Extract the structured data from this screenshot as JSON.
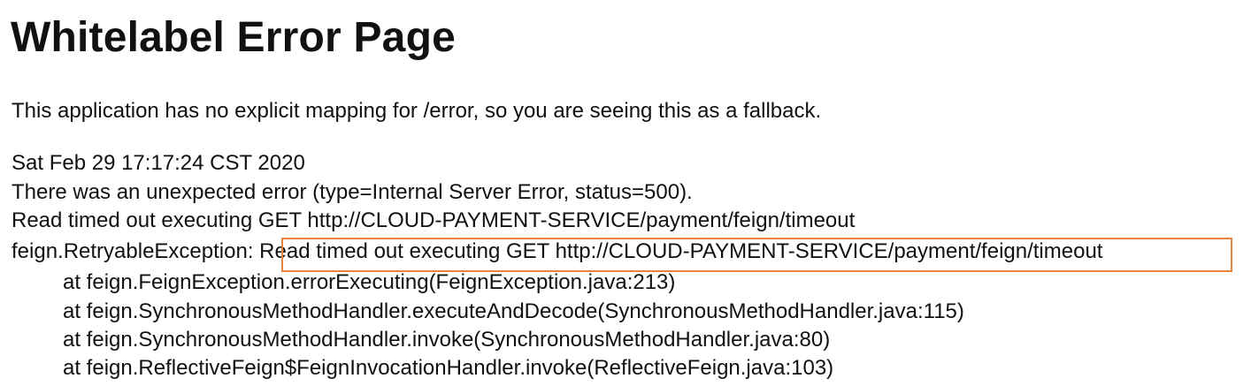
{
  "page": {
    "title": "Whitelabel Error Page",
    "fallback_message": "This application has no explicit mapping for /error, so you are seeing this as a fallback.",
    "timestamp": "Sat Feb 29 17:17:24 CST 2020",
    "error_summary": "There was an unexpected error (type=Internal Server Error, status=500).",
    "error_message": "Read timed out executing GET http://CLOUD-PAYMENT-SERVICE/payment/feign/timeout",
    "exception": {
      "prefix": "feign.RetryableException: ",
      "message": "Read timed out executing GET http://CLOUD-PAYMENT-SERVICE/payment/feign/timeout"
    },
    "stack_trace": [
      "at feign.FeignException.errorExecuting(FeignException.java:213)",
      "at feign.SynchronousMethodHandler.executeAndDecode(SynchronousMethodHandler.java:115)",
      "at feign.SynchronousMethodHandler.invoke(SynchronousMethodHandler.java:80)",
      "at feign.ReflectiveFeign$FeignInvocationHandler.invoke(ReflectiveFeign.java:103)"
    ]
  },
  "colors": {
    "background": "#ffffff",
    "text": "#111111",
    "highlight": "#e9823a"
  }
}
